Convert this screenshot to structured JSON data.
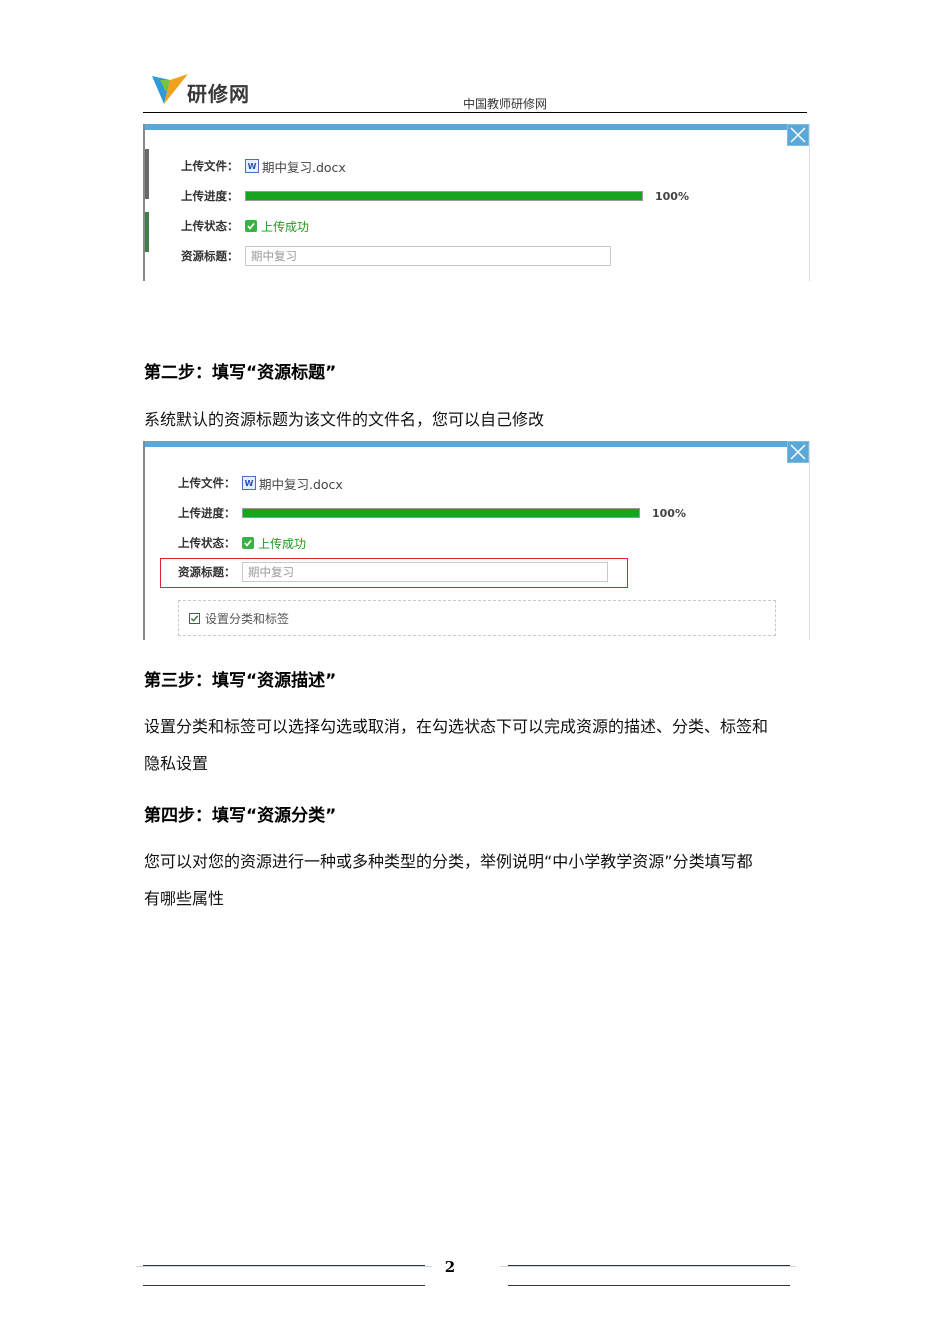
{
  "header": {
    "logo_text": "研修网",
    "title": "中国教师研修网"
  },
  "panel1": {
    "file_label": "上传文件：",
    "file_icon": "W",
    "file_name": "期中复习.docx",
    "progress_label": "上传进度：",
    "progress_value": 1.0,
    "progress_text": "100%",
    "status_label": "上传状态：",
    "status_text": "上传成功",
    "title_label": "资源标题：",
    "title_value": "期中复习"
  },
  "step2": {
    "heading": "第二步：填写“资源标题”",
    "text": "系统默认的资源标题为该文件的文件名，您可以自己修改"
  },
  "panel2": {
    "file_label": "上传文件：",
    "file_icon": "W",
    "file_name": "期中复习.docx",
    "progress_label": "上传进度：",
    "progress_value": 1.0,
    "progress_text": "100%",
    "status_label": "上传状态：",
    "status_text": "上传成功",
    "title_label": "资源标题：",
    "title_value": "期中复习",
    "checkbox_label": "设置分类和标签"
  },
  "step3": {
    "heading": "第三步：填写“资源描述”",
    "line1": "设置分类和标签可以选择勾选或取消，在勾选状态下可以完成资源的描述、分类、标签和",
    "line2": "隐私设置"
  },
  "step4": {
    "heading": "第四步：填写“资源分类”",
    "line1": " 您可以对您的资源进行一种或多种类型的分类，举例说明“中小学教学资源”分类填写都",
    "line2": "有哪些属性"
  },
  "footer": {
    "page_number": "2"
  },
  "colors": {
    "accent_blue": "#5aa7d8",
    "progress_green": "#16a51f",
    "success_green": "#1a9c1a",
    "highlight_red": "#e0262b"
  }
}
